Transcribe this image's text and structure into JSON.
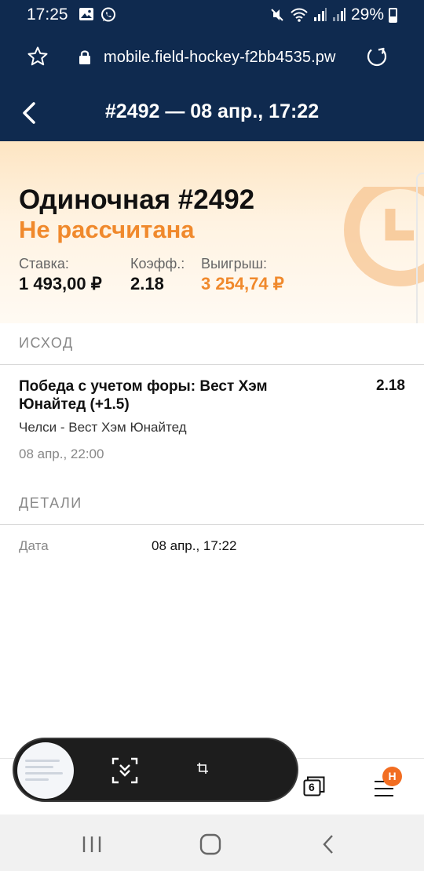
{
  "status_bar": {
    "time": "17:25",
    "battery": "29%",
    "left_icons": [
      "image-icon",
      "whatsapp-icon"
    ],
    "right_icons": [
      "mute-icon",
      "wifi-icon",
      "signal-icon",
      "signal-icon"
    ]
  },
  "browser": {
    "url": "mobile.field-hockey-f2bb4535.pw",
    "icons": [
      "star-icon",
      "lock-icon",
      "reload-icon"
    ],
    "tab_count": "6",
    "notification_badge": "H"
  },
  "header": {
    "title": "#2492 — 08 апр., 17:22"
  },
  "bet": {
    "title": "Одиночная #2492",
    "status": "Не рассчитана",
    "stake_label": "Ставка:",
    "stake_value": "1 493,00 ₽",
    "odds_label": "Коэфф.:",
    "odds_value": "2.18",
    "win_label": "Выигрыш:",
    "win_value": "3 254,74 ₽"
  },
  "outcome_section": {
    "label": "ИСХОД",
    "name_line1": "Победа с учетом форы: Вест Хэм",
    "name_line2": "Юнайтед (+1.5)",
    "odds": "2.18",
    "match": "Челси - Вест Хэм Юнайтед",
    "time": "08 апр., 22:00"
  },
  "details_section": {
    "label": "ДЕТАЛИ",
    "date_key": "Дата",
    "date_value": "08 апр., 17:22"
  },
  "colors": {
    "brand_navy": "#0f2a4f",
    "accent_orange": "#f0892c",
    "badge_orange": "#f26d21"
  }
}
